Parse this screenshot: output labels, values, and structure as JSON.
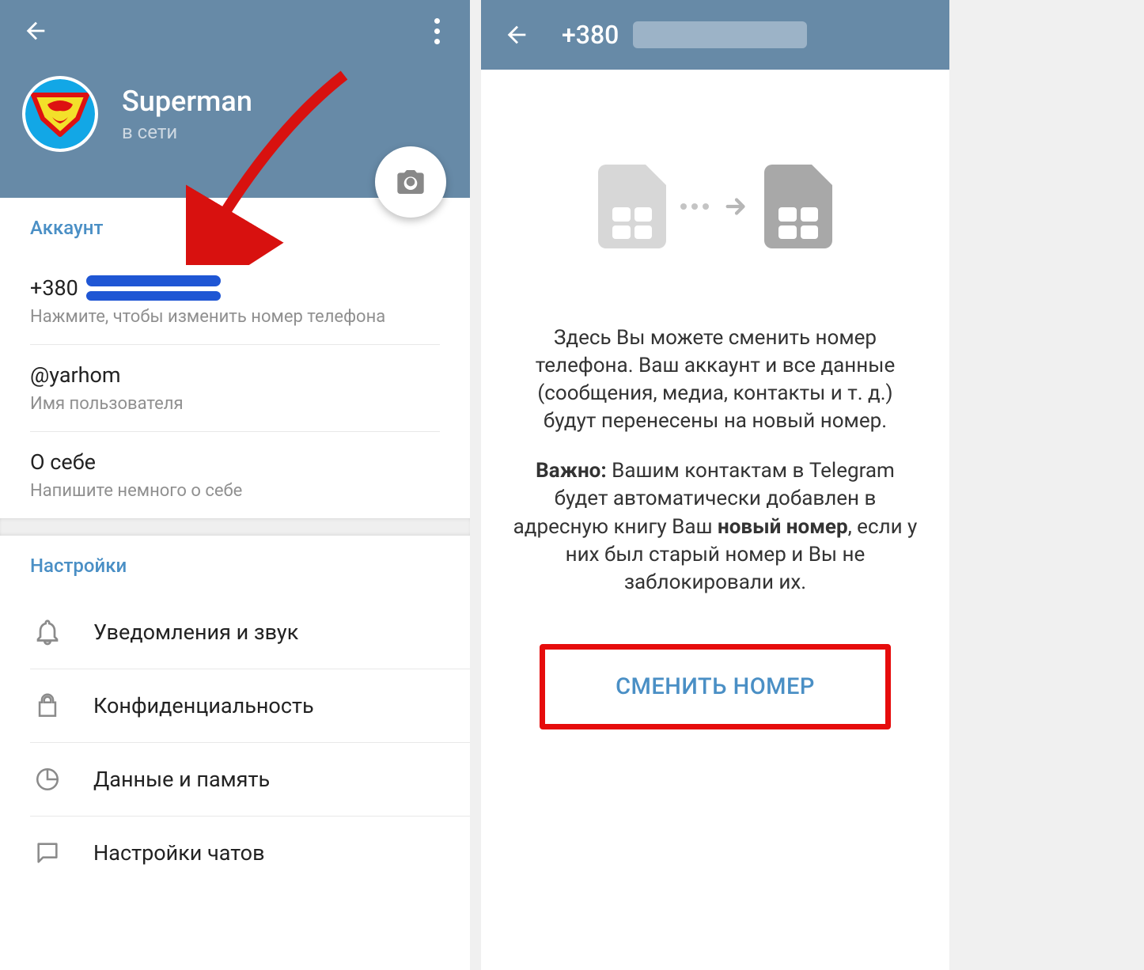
{
  "left": {
    "profile": {
      "name": "Superman",
      "status": "в сети"
    },
    "account": {
      "section_title": "Аккаунт",
      "phone_prefix": "+380",
      "phone_hint": "Нажмите, чтобы изменить номер телефона",
      "username": "@yarhom",
      "username_hint": "Имя пользователя",
      "bio_title": "О себе",
      "bio_hint": "Напишите немного о себе"
    },
    "settings": {
      "section_title": "Настройки",
      "items": [
        {
          "icon": "bell",
          "label": "Уведомления и звук"
        },
        {
          "icon": "lock",
          "label": "Конфиденциальность"
        },
        {
          "icon": "pie",
          "label": "Данные и память"
        },
        {
          "icon": "chat",
          "label": "Настройки чатов"
        }
      ]
    }
  },
  "right": {
    "header_prefix": "+380",
    "info": {
      "p1": "Здесь Вы можете сменить номер телефона. Ваш аккаунт и все данные (сообщения, медиа, контакты и т. д.) будут перенесены на новый номер.",
      "important_label": "Важно:",
      "p2_a": " Вашим контактам в Telegram будет автоматически добавлен в адресную книгу Ваш ",
      "p2_bold": "новый номер",
      "p2_b": ", если у них был старый номер и Вы не заблокировали их."
    },
    "button_label": "СМЕНИТЬ НОМЕР"
  }
}
